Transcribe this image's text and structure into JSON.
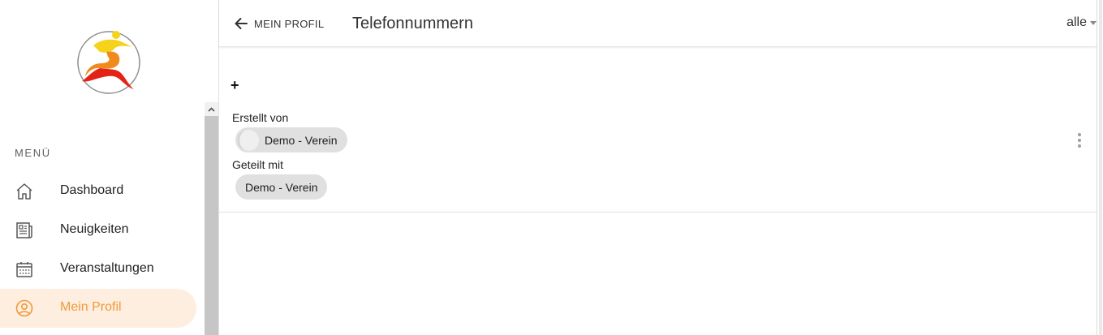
{
  "sidebar": {
    "menu_heading": "MENÜ",
    "items": [
      {
        "label": "Dashboard",
        "icon": "home-icon",
        "active": false
      },
      {
        "label": "Neuigkeiten",
        "icon": "newspaper-icon",
        "active": false
      },
      {
        "label": "Veranstaltungen",
        "icon": "calendar-icon",
        "active": false
      },
      {
        "label": "Mein Profil",
        "icon": "account-circle-icon",
        "active": true
      }
    ]
  },
  "header": {
    "back_label": "MEIN PROFIL",
    "title": "Telefonnummern",
    "filter_value": "alle"
  },
  "content": {
    "add_label": "+",
    "entry": {
      "created_by_label": "Erstellt von",
      "created_by_chip": "Demo - Verein",
      "shared_with_label": "Geteilt mit",
      "shared_with_chip": "Demo - Verein"
    }
  },
  "colors": {
    "accent": "#ef9a3c",
    "active_bg": "#fdeedf",
    "chip_bg": "#e0e0e0"
  }
}
